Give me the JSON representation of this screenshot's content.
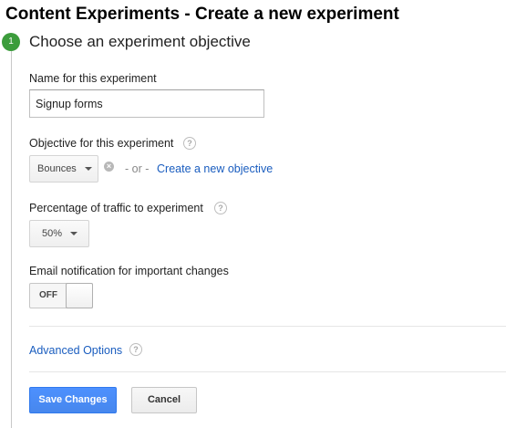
{
  "page": {
    "title": "Content Experiments - Create a new experiment"
  },
  "step": {
    "number": "1",
    "title": "Choose an experiment objective"
  },
  "name_field": {
    "label": "Name for this experiment",
    "value": "Signup forms"
  },
  "objective": {
    "label": "Objective for this experiment",
    "selected": "Bounces",
    "or_text": "- or -",
    "create_link": "Create a new objective"
  },
  "traffic": {
    "label": "Percentage of traffic to experiment",
    "selected": "50%"
  },
  "email": {
    "label": "Email notification for important changes",
    "toggle_state": "OFF"
  },
  "advanced": {
    "link": "Advanced Options"
  },
  "actions": {
    "save_label": "Save Changes",
    "cancel_label": "Cancel"
  },
  "icons": {
    "help": "?",
    "clear": "×"
  },
  "colors": {
    "step_badge": "#3c9c3c",
    "link": "#1a5dbf",
    "primary_button": "#4d90fe"
  }
}
